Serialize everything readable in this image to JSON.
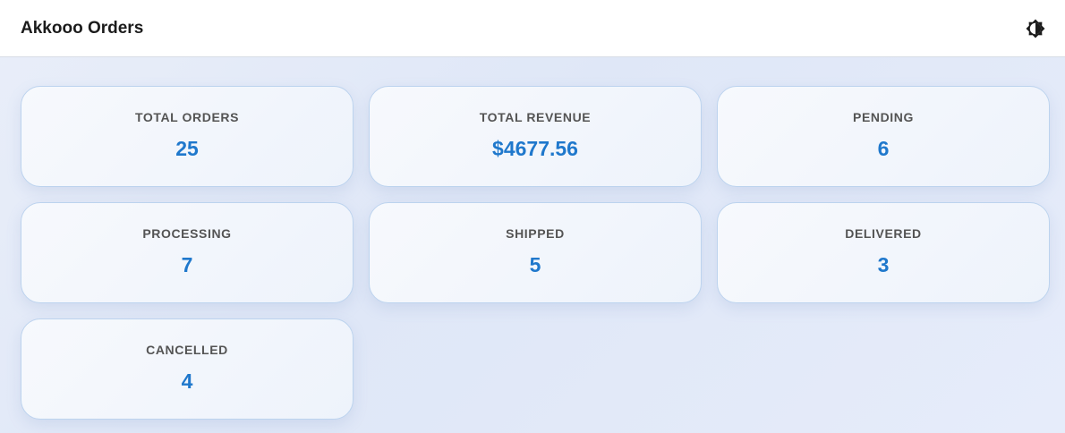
{
  "header": {
    "title": "Akkooo Orders",
    "theme_toggle_icon": "brightness-icon"
  },
  "stats": [
    {
      "label": "TOTAL ORDERS",
      "value": "25"
    },
    {
      "label": "TOTAL REVENUE",
      "value": "$4677.56"
    },
    {
      "label": "PENDING",
      "value": "6"
    },
    {
      "label": "PROCESSING",
      "value": "7"
    },
    {
      "label": "SHIPPED",
      "value": "5"
    },
    {
      "label": "DELIVERED",
      "value": "3"
    },
    {
      "label": "CANCELLED",
      "value": "4"
    }
  ],
  "colors": {
    "accent": "#1f78cc",
    "label": "#545454",
    "card_border": "#bcd3ee"
  }
}
